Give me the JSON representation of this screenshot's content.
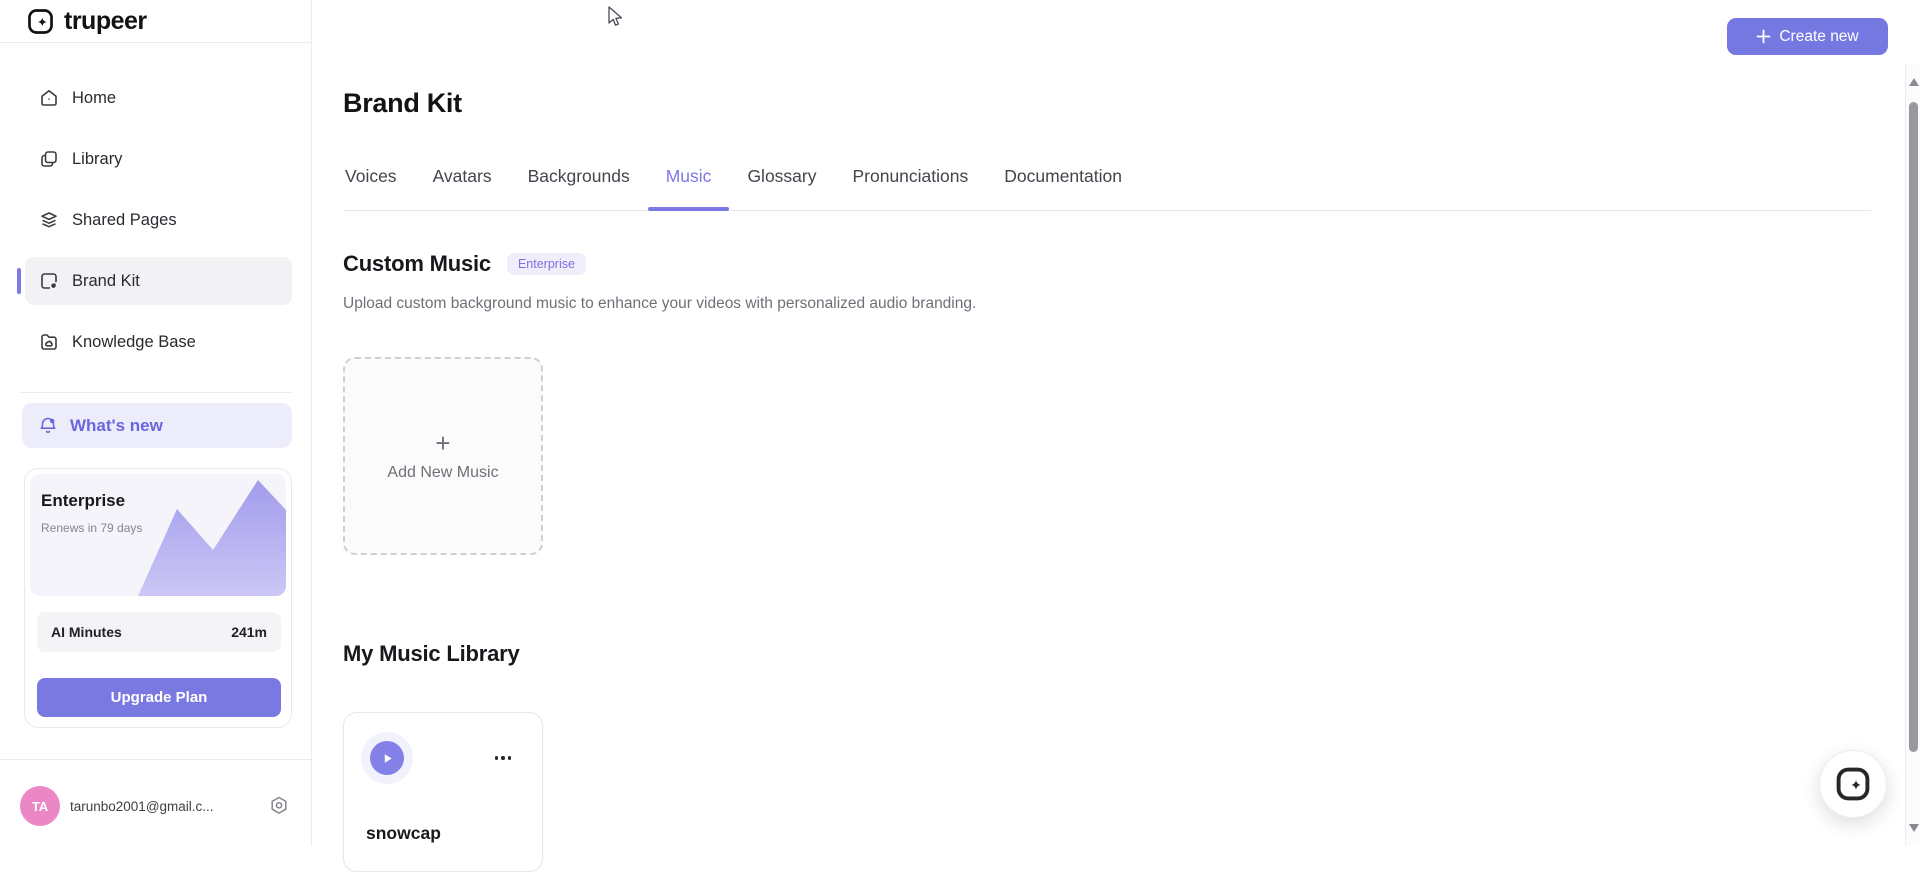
{
  "brand": {
    "name": "trupeer"
  },
  "sidebar": {
    "items": [
      {
        "label": "Home"
      },
      {
        "label": "Library"
      },
      {
        "label": "Shared Pages"
      },
      {
        "label": "Brand Kit"
      },
      {
        "label": "Knowledge Base"
      }
    ],
    "whats_new_label": "What's new",
    "plan_card": {
      "plan_name": "Enterprise",
      "renewal_text": "Renews in 79 days",
      "usage_label": "AI Minutes",
      "usage_value": "241m",
      "upgrade_label": "Upgrade Plan"
    },
    "user": {
      "initials": "TA",
      "email": "tarunbo2001@gmail.c..."
    }
  },
  "header": {
    "create_button_label": "Create new"
  },
  "main": {
    "title": "Brand Kit",
    "tabs": [
      {
        "label": "Voices"
      },
      {
        "label": "Avatars"
      },
      {
        "label": "Backgrounds"
      },
      {
        "label": "Music",
        "active": true
      },
      {
        "label": "Glossary"
      },
      {
        "label": "Pronunciations"
      },
      {
        "label": "Documentation"
      }
    ],
    "custom_music": {
      "title": "Custom Music",
      "badge": "Enterprise",
      "description": "Upload custom background music to enhance your videos with personalized audio branding.",
      "add_plus": "+",
      "add_label": "Add New Music"
    },
    "library": {
      "title": "My Music Library",
      "tracks": [
        {
          "name": "snowcap"
        }
      ]
    }
  },
  "colors": {
    "accent": "#7678e2",
    "accent_light": "#ececfb",
    "badge_bg": "#f1eefb",
    "badge_text": "#7b71e0",
    "avatar_pink": "#ec87c5",
    "graph_top": "#a29cec",
    "graph_bottom": "#cbc7f5"
  }
}
